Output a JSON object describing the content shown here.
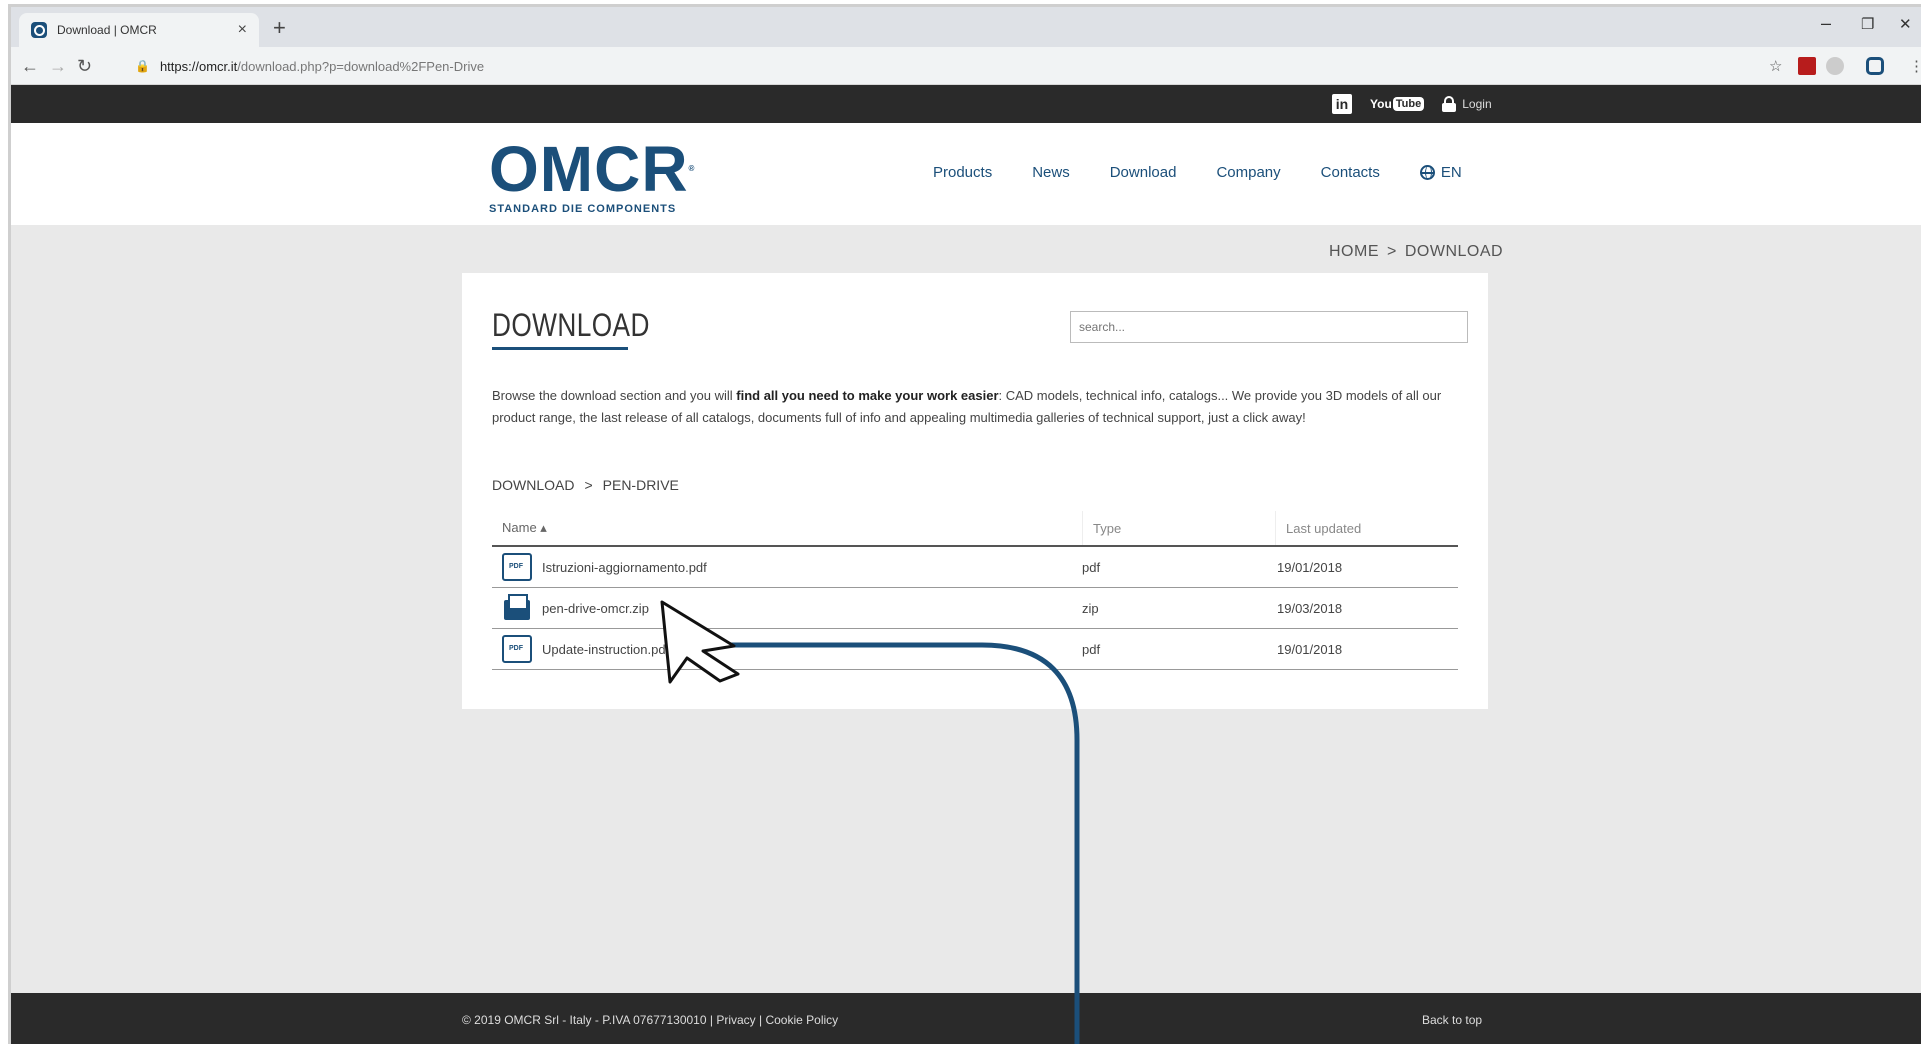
{
  "browser": {
    "tab_title": "Download | OMCR",
    "tab_close": "×",
    "new_tab": "+",
    "minimize": "–",
    "maximize": "❐",
    "close": "✕",
    "url_host": "https://omcr.it",
    "url_path": "/download.php?p=download%2FPen-Drive"
  },
  "topbar": {
    "linkedin": "in",
    "youtube_prefix": "You",
    "youtube_suffix": "Tube",
    "login": "Login"
  },
  "header": {
    "logo_text": "OMCR",
    "logo_tagline": "STANDARD DIE COMPONENTS",
    "nav": [
      "Products",
      "News",
      "Download",
      "Company",
      "Contacts",
      "EN"
    ]
  },
  "breadcrumb": {
    "home": "HOME",
    "separator": ">",
    "current": "DOWNLOAD"
  },
  "content": {
    "title": "DOWNLOAD",
    "search_placeholder": "search...",
    "intro_before": "Browse the download section and you will ",
    "intro_bold": "find all you need to make your work easier",
    "intro_after": ": CAD models, technical info, catalogs... We provide you 3D models of all our product range, the last release of all catalogs, documents full of info and appealing multimedia galleries of technical support, just a click away!",
    "subcrumb": {
      "root": "DOWNLOAD",
      "separator": ">",
      "current": "PEN-DRIVE"
    },
    "table": {
      "headers": {
        "name": "Name ▴",
        "type": "Type",
        "updated": "Last updated"
      },
      "rows": [
        {
          "icon": "pdf-icon",
          "name": "Istruzioni-aggiornamento.pdf",
          "type": "pdf",
          "updated": "19/01/2018"
        },
        {
          "icon": "zip-icon",
          "name": "pen-drive-omcr.zip",
          "type": "zip",
          "updated": "19/03/2018"
        },
        {
          "icon": "pdf-icon",
          "name": "Update-instruction.pdf",
          "type": "pdf",
          "updated": "19/01/2018"
        }
      ]
    }
  },
  "footer": {
    "copyright": "© 2019 OMCR Srl - Italy - P.IVA 07677130010 | ",
    "privacy": "Privacy",
    "sep": " | ",
    "cookie": "Cookie Policy",
    "back_to_top": "Back to top"
  },
  "colors": {
    "brand": "#1b4f7a",
    "dark_bar": "#2a2a2a",
    "page_bg": "#e9e9e9"
  }
}
